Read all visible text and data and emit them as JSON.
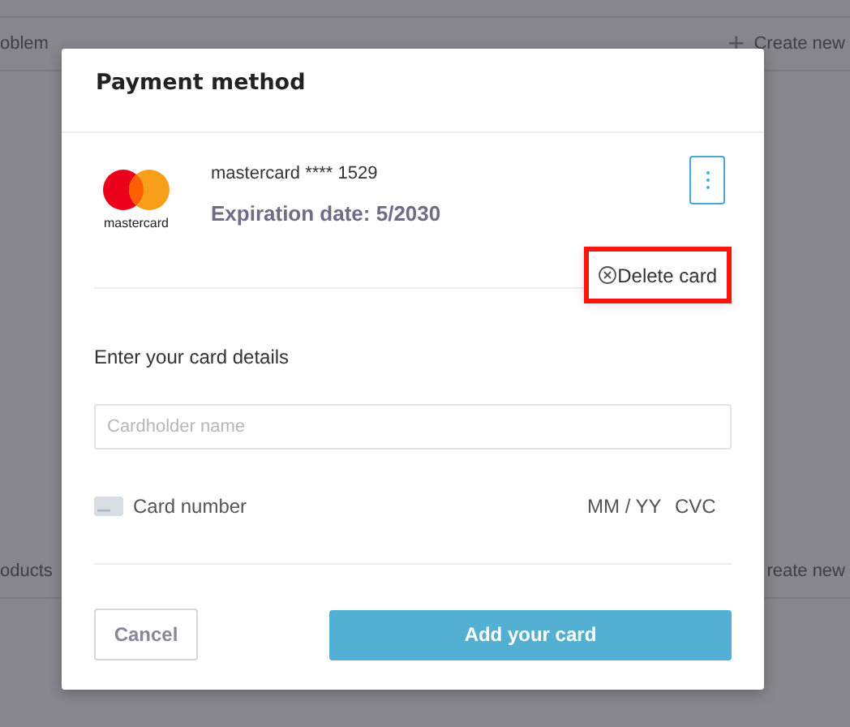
{
  "background": {
    "rows": [
      {
        "title": "oblem",
        "action": "Create new",
        "action_icon": "+"
      },
      {
        "title": "oducts",
        "action": "reate new"
      }
    ]
  },
  "dialog": {
    "title": "Payment method",
    "saved_card": {
      "logo_text": "mastercard",
      "label": "mastercard **** 1529",
      "expiry": "Expiration date: 5/2030",
      "menu": {
        "open": true,
        "items": [
          {
            "label": "Delete card",
            "highlighted": true
          }
        ]
      }
    },
    "form": {
      "heading": "Enter your card details",
      "cardholder": {
        "placeholder": "Cardholder name"
      },
      "card_number": {
        "placeholder": "Card number"
      },
      "expiry": {
        "placeholder": "MM / YY"
      },
      "cvc": {
        "placeholder": "CVC"
      }
    },
    "buttons": [
      {
        "label": "Cancel",
        "kind": "secondary"
      },
      {
        "label": "Add your card",
        "kind": "primary"
      }
    ]
  }
}
